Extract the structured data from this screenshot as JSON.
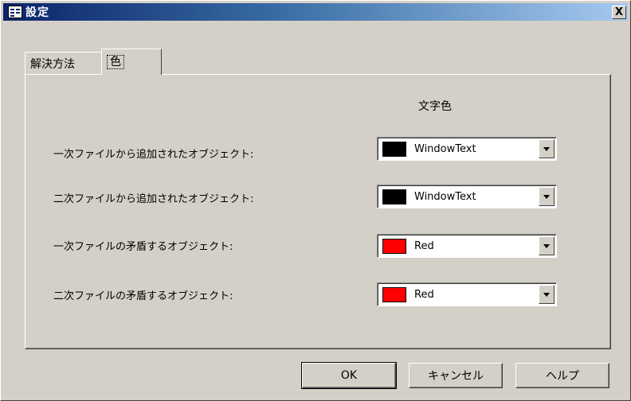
{
  "window": {
    "title": "設定",
    "close_label": "X"
  },
  "tabs": [
    {
      "label": "解決方法",
      "active": false
    },
    {
      "label": "色",
      "active": true
    }
  ],
  "panel": {
    "column_header": "文字色",
    "rows": [
      {
        "label": "一次ファイルから追加されたオブジェクト:",
        "color_name": "WindowText",
        "swatch": "#000000"
      },
      {
        "label": "二次ファイルから追加されたオブジェクト:",
        "color_name": "WindowText",
        "swatch": "#000000"
      },
      {
        "label": "一次ファイルの矛盾するオブジェクト:",
        "color_name": "Red",
        "swatch": "#ff0000"
      },
      {
        "label": "二次ファイルの矛盾するオブジェクト:",
        "color_name": "Red",
        "swatch": "#ff0000"
      }
    ]
  },
  "buttons": {
    "ok": "OK",
    "cancel": "キャンセル",
    "help": "ヘルプ"
  },
  "icons": {
    "title": "window-app-icon",
    "dropdown": "chevron-down-icon"
  }
}
